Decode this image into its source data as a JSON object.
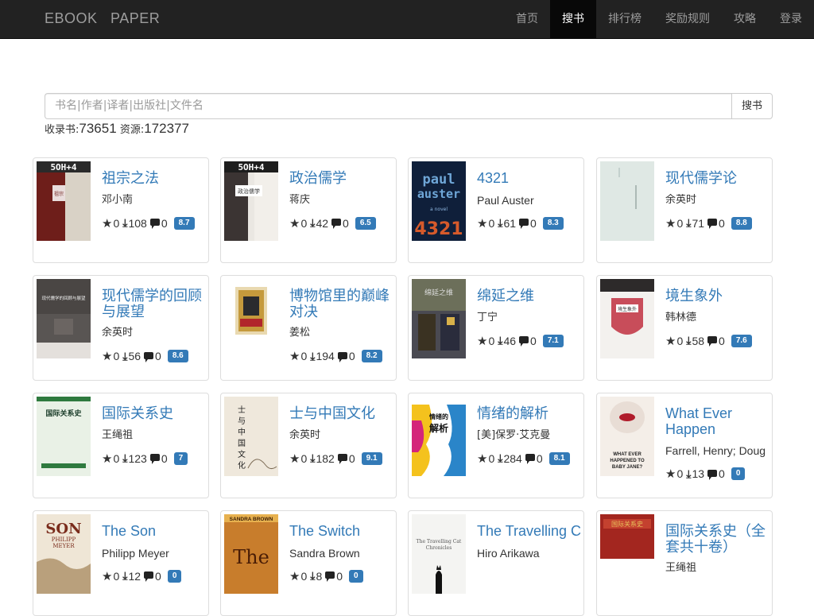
{
  "brand": "EBOOK   PAPER",
  "nav": [
    "首页",
    "搜书",
    "排行榜",
    "奖励规则",
    "攻略",
    "登录"
  ],
  "active_nav": 1,
  "search": {
    "placeholder": "书名|作者|译者|出版社|文件名",
    "button": "搜书"
  },
  "stats": {
    "books_label": "收录书:",
    "books_count": "73651",
    "resources_label": "资源:",
    "resources_count": "172377"
  },
  "books": [
    {
      "title": "祖宗之法",
      "author": "邓小南",
      "stars": "0",
      "downloads": "108",
      "comments": "0",
      "score": "8.7"
    },
    {
      "title": "政治儒学",
      "author": "蒋庆",
      "stars": "0",
      "downloads": "42",
      "comments": "0",
      "score": "6.5"
    },
    {
      "title": "4321",
      "author": "Paul Auster",
      "stars": "0",
      "downloads": "61",
      "comments": "0",
      "score": "8.3"
    },
    {
      "title": "现代儒学论",
      "author": "余英时",
      "stars": "0",
      "downloads": "71",
      "comments": "0",
      "score": "8.8"
    },
    {
      "title": "现代儒学的回顾与展望",
      "author": "余英时",
      "stars": "0",
      "downloads": "56",
      "comments": "0",
      "score": "8.6"
    },
    {
      "title": "博物馆里的巅峰对决",
      "author": "姜松",
      "stars": "0",
      "downloads": "194",
      "comments": "0",
      "score": "8.2"
    },
    {
      "title": "绵延之维",
      "author": "丁宁",
      "stars": "0",
      "downloads": "46",
      "comments": "0",
      "score": "7.1"
    },
    {
      "title": "境生象外",
      "author": "韩林德",
      "stars": "0",
      "downloads": "58",
      "comments": "0",
      "score": "7.6"
    },
    {
      "title": "国际关系史",
      "author": "王绳祖",
      "stars": "0",
      "downloads": "123",
      "comments": "0",
      "score": "7"
    },
    {
      "title": "士与中国文化",
      "author": "余英时",
      "stars": "0",
      "downloads": "182",
      "comments": "0",
      "score": "9.1"
    },
    {
      "title": "情绪的解析",
      "author": "[美]保罗·艾克曼",
      "stars": "0",
      "downloads": "284",
      "comments": "0",
      "score": "8.1"
    },
    {
      "title": "What Ever Happen",
      "author": "Farrell, Henry; Doug",
      "stars": "0",
      "downloads": "13",
      "comments": "0",
      "score": "0"
    },
    {
      "title": "The Son",
      "author": "Philipp Meyer",
      "stars": "0",
      "downloads": "12",
      "comments": "0",
      "score": "0"
    },
    {
      "title": "The Switch",
      "author": "Sandra Brown",
      "stars": "0",
      "downloads": "8",
      "comments": "0",
      "score": "0"
    },
    {
      "title": "The Travelling C",
      "author": "Hiro Arikawa",
      "stars": "",
      "downloads": "",
      "comments": "",
      "score": ""
    },
    {
      "title": "国际关系史（全套共十卷）",
      "author": "王绳祖",
      "stars": "",
      "downloads": "",
      "comments": "",
      "score": ""
    }
  ],
  "covers": {
    "c2_top": "paul",
    "c2_mid": "auster",
    "c2_small": "a novel",
    "c2_num": "4321",
    "c12_big": "SON",
    "c12_name": "PHILIPP",
    "c12_name2": "MEYER",
    "c13_author": "SANDRA BROWN",
    "c13_big": "The",
    "c10_t1": "情绪的",
    "c10_t2": "解析",
    "c11_t": "WHAT EVER HAPPENED TO BABY JANE?"
  },
  "colors": {
    "navbar": "#222222",
    "link": "#337ab7",
    "badge": "#337ab7"
  }
}
